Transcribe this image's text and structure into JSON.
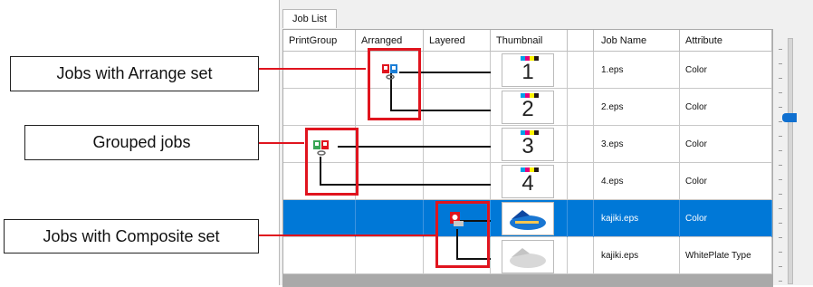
{
  "tab": {
    "label": "Job List"
  },
  "columns": [
    "PrintGroup",
    "Arranged",
    "Layered",
    "Thumbnail",
    "",
    "Job Name",
    "Attribute"
  ],
  "rows": [
    {
      "thumb": "1",
      "job": "1.eps",
      "attr": "Color",
      "selected": false
    },
    {
      "thumb": "2",
      "job": "2.eps",
      "attr": "Color",
      "selected": false
    },
    {
      "thumb": "3",
      "job": "3.eps",
      "attr": "Color",
      "selected": false
    },
    {
      "thumb": "4",
      "job": "4.eps",
      "attr": "Color",
      "selected": false
    },
    {
      "thumb": "",
      "job": "kajiki.eps",
      "attr": "Color",
      "selected": true
    },
    {
      "thumb": "",
      "job": "kajiki.eps",
      "attr": "WhitePlate Type",
      "selected": false
    }
  ],
  "callouts": {
    "arrange": "Jobs with Arrange set",
    "grouped": "Grouped jobs",
    "composite": "Jobs with Composite set"
  },
  "colors": {
    "selection": "#0078d7",
    "annotation_red": "#e0141e",
    "cmyk": [
      "#00a0e9",
      "#e4007f",
      "#fff100",
      "#231815"
    ]
  }
}
